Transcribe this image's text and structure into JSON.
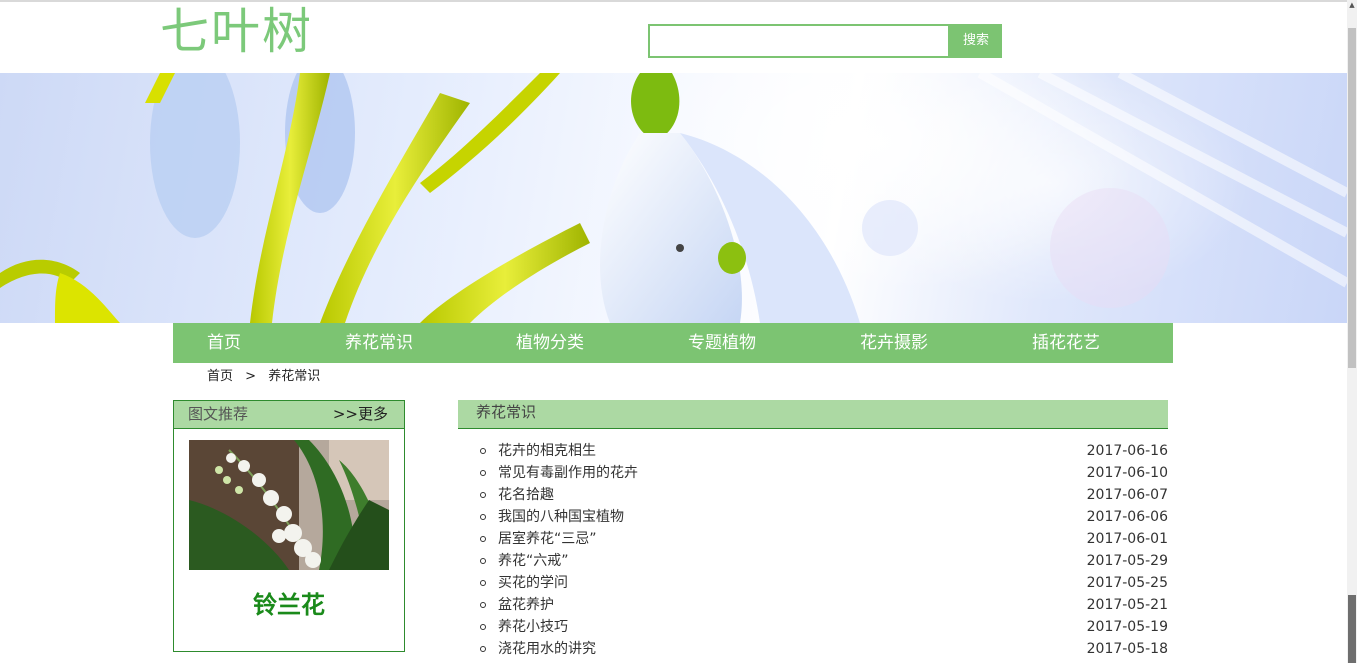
{
  "header": {
    "logo_text": "七叶树",
    "search": {
      "value": "",
      "placeholder": ""
    },
    "search_button": "搜索"
  },
  "nav": {
    "items": [
      {
        "label": "首页"
      },
      {
        "label": "养花常识"
      },
      {
        "label": "植物分类"
      },
      {
        "label": "专题植物"
      },
      {
        "label": "花卉摄影"
      },
      {
        "label": "插花花艺"
      }
    ]
  },
  "breadcrumb": {
    "home": "首页",
    "separator": ">",
    "current": "养花常识"
  },
  "sidebar": {
    "title": "图文推荐",
    "more": ">>更多",
    "image_subject": "lily-of-the-valley photo",
    "caption": "铃兰花"
  },
  "main": {
    "title": "养花常识",
    "articles": [
      {
        "title": "花卉的相克相生",
        "date": "2017-06-16"
      },
      {
        "title": "常见有毒副作用的花卉",
        "date": "2017-06-10"
      },
      {
        "title": "花名拾趣",
        "date": "2017-06-07"
      },
      {
        "title": "我国的八种国宝植物",
        "date": "2017-06-06"
      },
      {
        "title": "居室养花“三忌”",
        "date": "2017-06-01"
      },
      {
        "title": "养花“六戒”",
        "date": "2017-05-29"
      },
      {
        "title": "买花的学问",
        "date": "2017-05-25"
      },
      {
        "title": "盆花养护",
        "date": "2017-05-21"
      },
      {
        "title": "养花小技巧",
        "date": "2017-05-19"
      },
      {
        "title": "浇花用水的讲究",
        "date": "2017-05-18"
      }
    ]
  },
  "colors": {
    "accent": "#7cc472",
    "accent_light": "#acd9a3",
    "caption_green": "#1a8a1a",
    "logo": "#7cc97a"
  }
}
